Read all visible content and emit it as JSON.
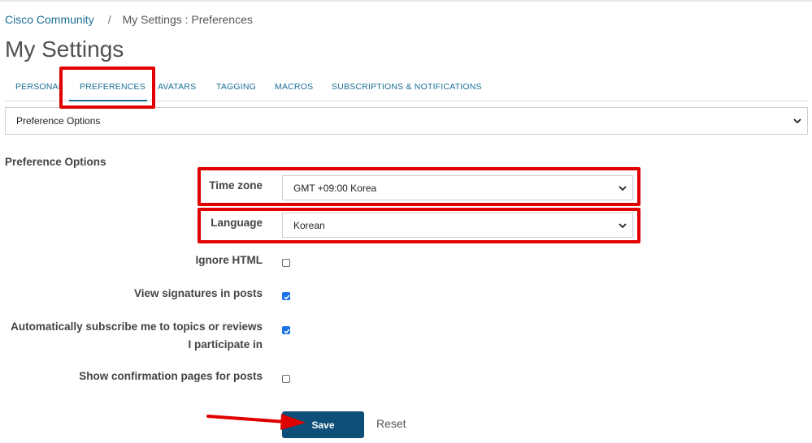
{
  "breadcrumb": {
    "home": "Cisco Community",
    "separator": "/",
    "current": "My Settings : Preferences"
  },
  "page_title": "My Settings",
  "tabs": [
    {
      "label": "PERSONAL"
    },
    {
      "label": "PREFERENCES",
      "active": true
    },
    {
      "label": "AVATARS"
    },
    {
      "label": "TAGGING"
    },
    {
      "label": "MACROS"
    },
    {
      "label": "SUBSCRIPTIONS & NOTIFICATIONS"
    }
  ],
  "section_select": {
    "value": "Preference Options"
  },
  "section_title": "Preference Options",
  "fields": {
    "timezone": {
      "label": "Time zone",
      "value": "GMT +09:00 Korea"
    },
    "language": {
      "label": "Language",
      "value": "Korean"
    },
    "ignore_html": {
      "label": "Ignore HTML",
      "checked": false
    },
    "view_signatures": {
      "label": "View signatures in posts",
      "checked": true
    },
    "auto_subscribe": {
      "label_line1": "Automatically subscribe me to topics or reviews",
      "label_line2": "I participate in",
      "checked": true
    },
    "show_confirmation": {
      "label": "Show confirmation pages for posts",
      "checked": false
    }
  },
  "actions": {
    "save_label": "Save",
    "reset_label": "Reset"
  },
  "colors": {
    "link": "#1a6e95",
    "save_button": "#0d4f78",
    "highlight": "#e00000",
    "checkbox_checked": "#1a73e8"
  }
}
